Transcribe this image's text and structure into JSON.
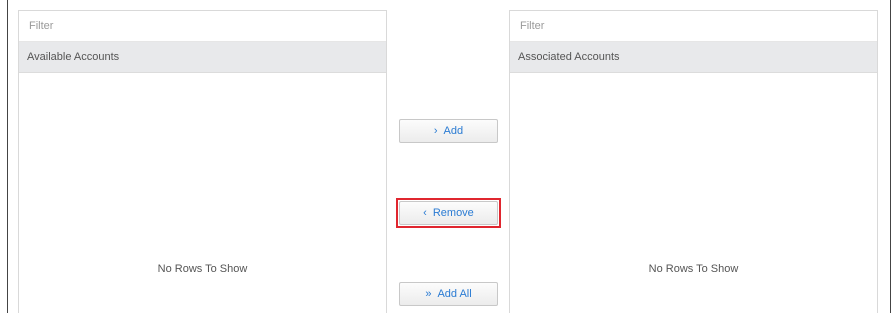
{
  "left_panel": {
    "filter_placeholder": "Filter",
    "header": "Available Accounts",
    "empty_text": "No Rows To Show"
  },
  "right_panel": {
    "filter_placeholder": "Filter",
    "header": "Associated Accounts",
    "empty_text": "No Rows To Show"
  },
  "buttons": {
    "add": {
      "icon": "›",
      "label": "Add"
    },
    "remove": {
      "icon": "‹",
      "label": "Remove"
    },
    "add_all": {
      "icon": "»",
      "label": "Add All"
    }
  },
  "highlight_color": "#e0262f",
  "accent_color": "#2a7bd3"
}
